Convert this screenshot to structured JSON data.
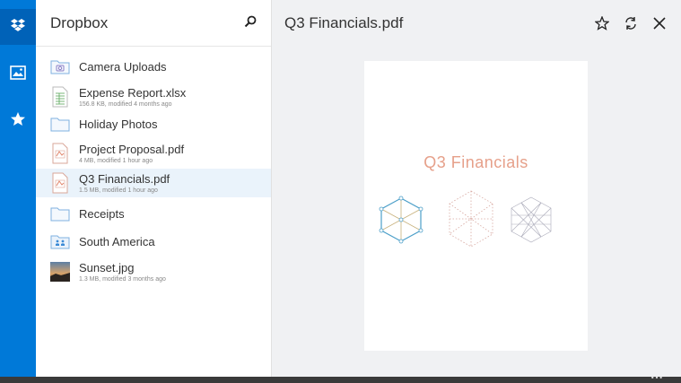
{
  "app": {
    "title": "Dropbox"
  },
  "rail": {
    "items": [
      {
        "name": "dropbox-icon"
      },
      {
        "name": "photos-icon"
      },
      {
        "name": "favorites-icon"
      }
    ]
  },
  "sidebar": {
    "search_icon": "search-icon",
    "items": [
      {
        "name": "Camera Uploads",
        "meta": "",
        "type": "camera-folder"
      },
      {
        "name": "Expense Report.xlsx",
        "meta": "156.8 KB, modified 4 months ago",
        "type": "spreadsheet"
      },
      {
        "name": "Holiday Photos",
        "meta": "",
        "type": "folder"
      },
      {
        "name": "Project Proposal.pdf",
        "meta": "4 MB, modified 1 hour ago",
        "type": "pdf"
      },
      {
        "name": "Q3 Financials.pdf",
        "meta": "1.5 MB, modified 1 hour ago",
        "type": "pdf",
        "selected": true
      },
      {
        "name": "Receipts",
        "meta": "",
        "type": "folder"
      },
      {
        "name": "South America",
        "meta": "",
        "type": "shared-folder"
      },
      {
        "name": "Sunset.jpg",
        "meta": "1.3 MB, modified 3 months ago",
        "type": "image"
      }
    ]
  },
  "preview": {
    "title": "Q3 Financials.pdf",
    "page_heading": "Q3 Financials",
    "actions": [
      "star-icon",
      "sync-icon",
      "close-icon"
    ]
  },
  "statusbar": {
    "more": "•••"
  },
  "colors": {
    "accent": "#0079d8",
    "accent_dark": "#0062b8",
    "selected_row": "#eaf3fb",
    "pdf_title": "#e6a08a"
  }
}
